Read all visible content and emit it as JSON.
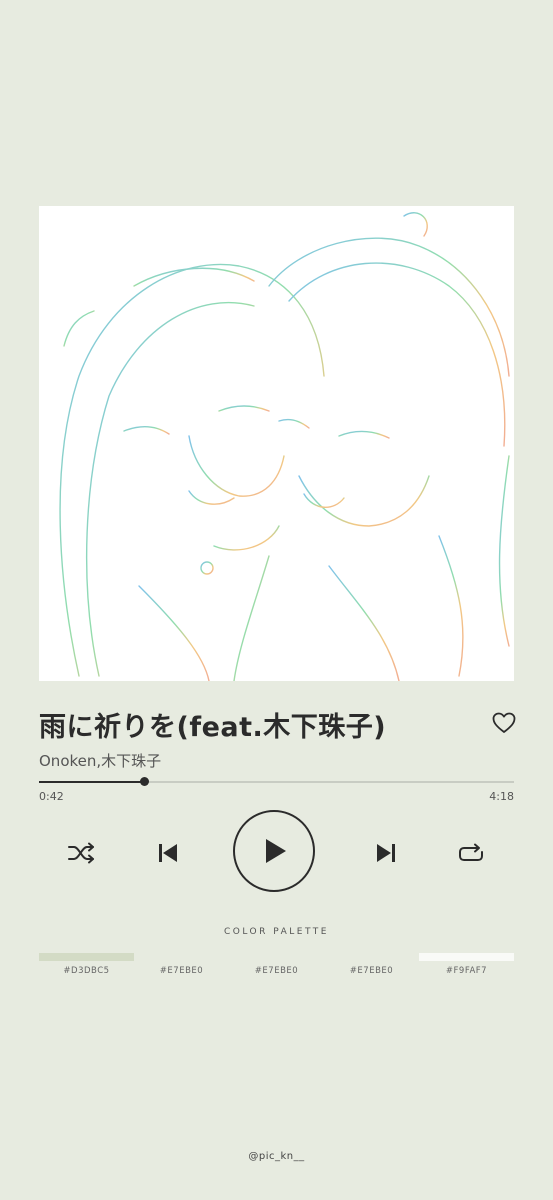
{
  "song": {
    "title": "雨に祈りを(feat.木下珠子)",
    "artist": "Onoken,木下珠子",
    "progress_fraction": 0.22
  },
  "player": {
    "current_time": "0:42",
    "total_time": "4:18",
    "liked": false
  },
  "icons": {
    "like": "heart-outline-icon",
    "shuffle": "shuffle-icon",
    "previous": "skip-previous-icon",
    "play": "play-icon",
    "next": "skip-next-icon",
    "repeat": "repeat-icon"
  },
  "palette": {
    "title": "COLOR PALETTE",
    "swatches": [
      {
        "code": "#D3DBC5",
        "color": "#D3DBC5"
      },
      {
        "code": "#E7EBE0",
        "color": "#E7EBE0"
      },
      {
        "code": "#E7EBE0",
        "color": "#E7EBE0"
      },
      {
        "code": "#E7EBE0",
        "color": "#E7EBE0"
      },
      {
        "code": "#F9FAF7",
        "color": "#F9FAF7"
      }
    ]
  },
  "credit": "@pic_kn__",
  "colors": {
    "background": "#E7EBE0",
    "text_dark": "#2b2b2b",
    "artwork_bg": "#FFFFFF"
  }
}
